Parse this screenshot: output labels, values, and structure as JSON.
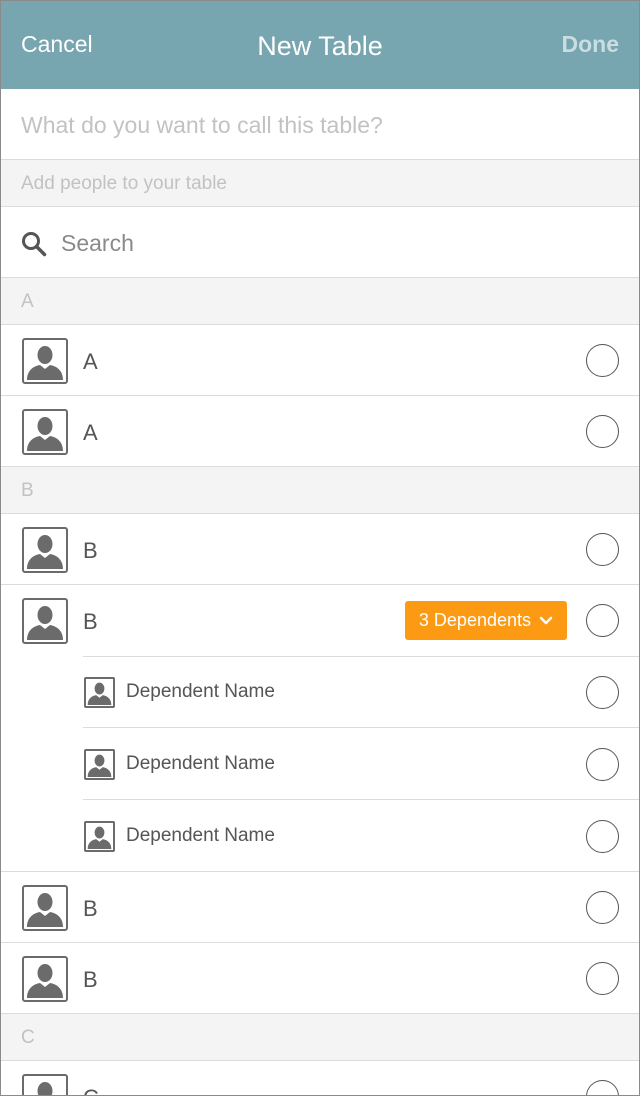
{
  "navbar": {
    "cancel_label": "Cancel",
    "title": "New Table",
    "done_label": "Done"
  },
  "name_field": {
    "value": "",
    "placeholder": "What do you want to call this table?"
  },
  "add_people_label": "Add people to your table",
  "search": {
    "value": "",
    "placeholder": "Search",
    "icon": "search-icon"
  },
  "sections": [
    {
      "letter": "A",
      "contacts": [
        {
          "name": "A"
        },
        {
          "name": "A"
        }
      ]
    },
    {
      "letter": "B",
      "contacts": [
        {
          "name": "B"
        },
        {
          "name": "B",
          "dependents_badge": "3 Dependents",
          "dependents": [
            {
              "name": "Dependent Name"
            },
            {
              "name": "Dependent Name"
            },
            {
              "name": "Dependent Name"
            }
          ]
        },
        {
          "name": "B"
        },
        {
          "name": "B"
        }
      ]
    },
    {
      "letter": "C",
      "contacts": [
        {
          "name": "C"
        }
      ]
    }
  ],
  "colors": {
    "navbar": "#77a5b0",
    "badge": "#fc9a13",
    "section_bg": "#f4f4f4",
    "avatar": "#6b6b6b"
  }
}
